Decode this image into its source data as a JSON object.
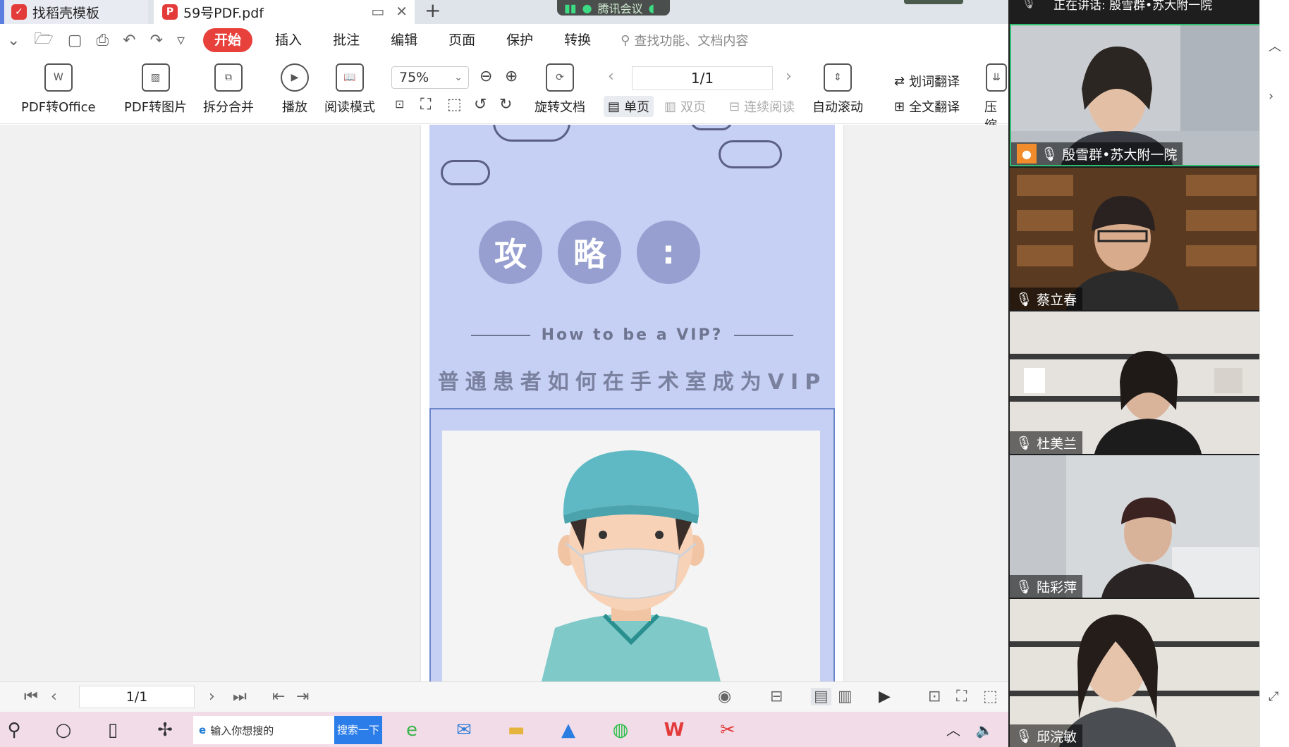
{
  "tabs": [
    {
      "label": "找稻壳模板",
      "active": false
    },
    {
      "label": "59号PDF.pdf",
      "active": true
    }
  ],
  "meeting_pill": "腾讯会议",
  "menu": {
    "items": [
      "开始",
      "插入",
      "批注",
      "编辑",
      "页面",
      "保护",
      "转换"
    ],
    "search_placeholder": "查找功能、文档内容"
  },
  "ribbon": {
    "pdf_to_office": "PDF转Office",
    "pdf_to_image": "PDF转图片",
    "split_merge": "拆分合并",
    "play": "播放",
    "reading_mode": "阅读模式",
    "zoom": "75%",
    "rotate_doc": "旋转文档",
    "page_indicator": "1/1",
    "single_page": "单页",
    "double_page": "双页",
    "continuous": "连续阅读",
    "auto_scroll": "自动滚动",
    "word_translate": "划词翻译",
    "full_translate": "全文翻译",
    "compress": "压缩"
  },
  "poster": {
    "circles": [
      "攻",
      "略",
      ":"
    ],
    "subtitle_en": "How to be a VIP?",
    "title_cn": "普通患者如何在手术室成为VIP"
  },
  "statusbar": {
    "page": "1/1"
  },
  "taskbar": {
    "search_placeholder": "输入你想搜的",
    "search_button": "搜索一下"
  },
  "video": {
    "speaking_label": "正在讲话: 殷雪群•苏大附一院",
    "participants": [
      {
        "name": "殷雪群•苏大附一院",
        "host": true
      },
      {
        "name": "蔡立春",
        "host": false
      },
      {
        "name": "杜美兰",
        "host": false
      },
      {
        "name": "陆彩萍",
        "host": false
      },
      {
        "name": "邱浣敏",
        "host": false
      }
    ]
  },
  "colors": {
    "accent_red": "#e8413c",
    "poster_bg": "#c6d0f4",
    "circle_fill": "#969fcf",
    "active_speaker_border": "#2fbf71"
  }
}
